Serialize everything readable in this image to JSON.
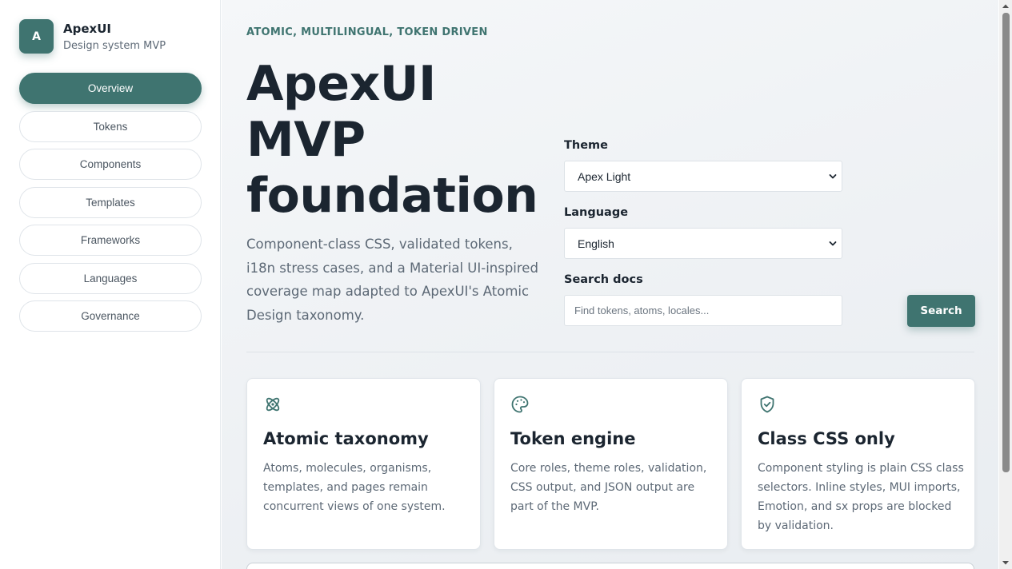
{
  "brand": {
    "logo_letter": "A",
    "name": "ApexUI",
    "subtitle": "Design system MVP"
  },
  "sidebar": {
    "items": [
      {
        "label": "Overview",
        "active": true
      },
      {
        "label": "Tokens",
        "active": false
      },
      {
        "label": "Components",
        "active": false
      },
      {
        "label": "Templates",
        "active": false
      },
      {
        "label": "Frameworks",
        "active": false
      },
      {
        "label": "Languages",
        "active": false
      },
      {
        "label": "Governance",
        "active": false
      }
    ]
  },
  "hero": {
    "eyebrow": "ATOMIC, MULTILINGUAL, TOKEN DRIVEN",
    "title_line1": "ApexUI",
    "title_line2": "MVP",
    "title_line3": "foundation",
    "description": "Component-class CSS, validated tokens, i18n stress cases, and a Material UI-inspired coverage map adapted to ApexUI's Atomic Design taxonomy."
  },
  "controls": {
    "theme_label": "Theme",
    "theme_value": "Apex Light",
    "language_label": "Language",
    "language_value": "English",
    "search_label": "Search docs",
    "search_placeholder": "Find tokens, atoms, locales...",
    "search_value": "",
    "search_button": "Search"
  },
  "cards": [
    {
      "icon": "atom-icon",
      "title": "Atomic taxonomy",
      "description": "Atoms, molecules, organisms, templates, and pages remain concurrent views of one system."
    },
    {
      "icon": "palette-icon",
      "title": "Token engine",
      "description": "Core roles, theme roles, validation, CSS output, and JSON output are part of the MVP."
    },
    {
      "icon": "shield-check-icon",
      "title": "Class CSS only",
      "description": "Component styling is plain CSS class selectors. Inline styles, MUI imports, Emotion, and sx props are blocked by validation."
    }
  ],
  "colors": {
    "accent": "#3f7470",
    "text": "#1b2530",
    "muted": "#5d6976"
  }
}
